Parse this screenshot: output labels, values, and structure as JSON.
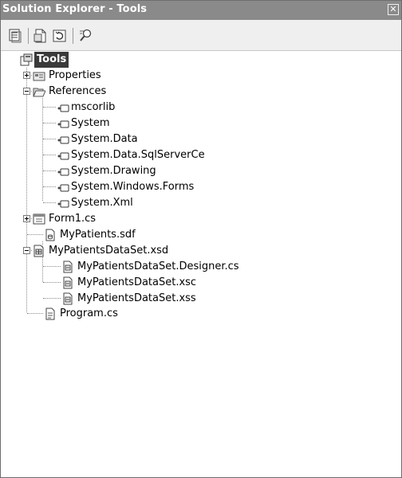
{
  "window": {
    "title": "Solution Explorer - Tools",
    "close_glyph": "✕"
  },
  "toolbar": {
    "buttons": [
      {
        "name": "properties-icon"
      },
      {
        "name": "show-all-files-icon"
      },
      {
        "name": "refresh-icon"
      },
      {
        "name": "class-view-icon"
      }
    ]
  },
  "tree": {
    "root": "Tools",
    "properties": "Properties",
    "references": "References",
    "refs": [
      "mscorlib",
      "System",
      "System.Data",
      "System.Data.SqlServerCe",
      "System.Drawing",
      "System.Windows.Forms",
      "System.Xml"
    ],
    "form1": "Form1.cs",
    "sdf": "MyPatients.sdf",
    "xsd": "MyPatientsDataSet.xsd",
    "xsd_children": [
      "MyPatientsDataSet.Designer.cs",
      "MyPatientsDataSet.xsc",
      "MyPatientsDataSet.xss"
    ],
    "program": "Program.cs"
  }
}
